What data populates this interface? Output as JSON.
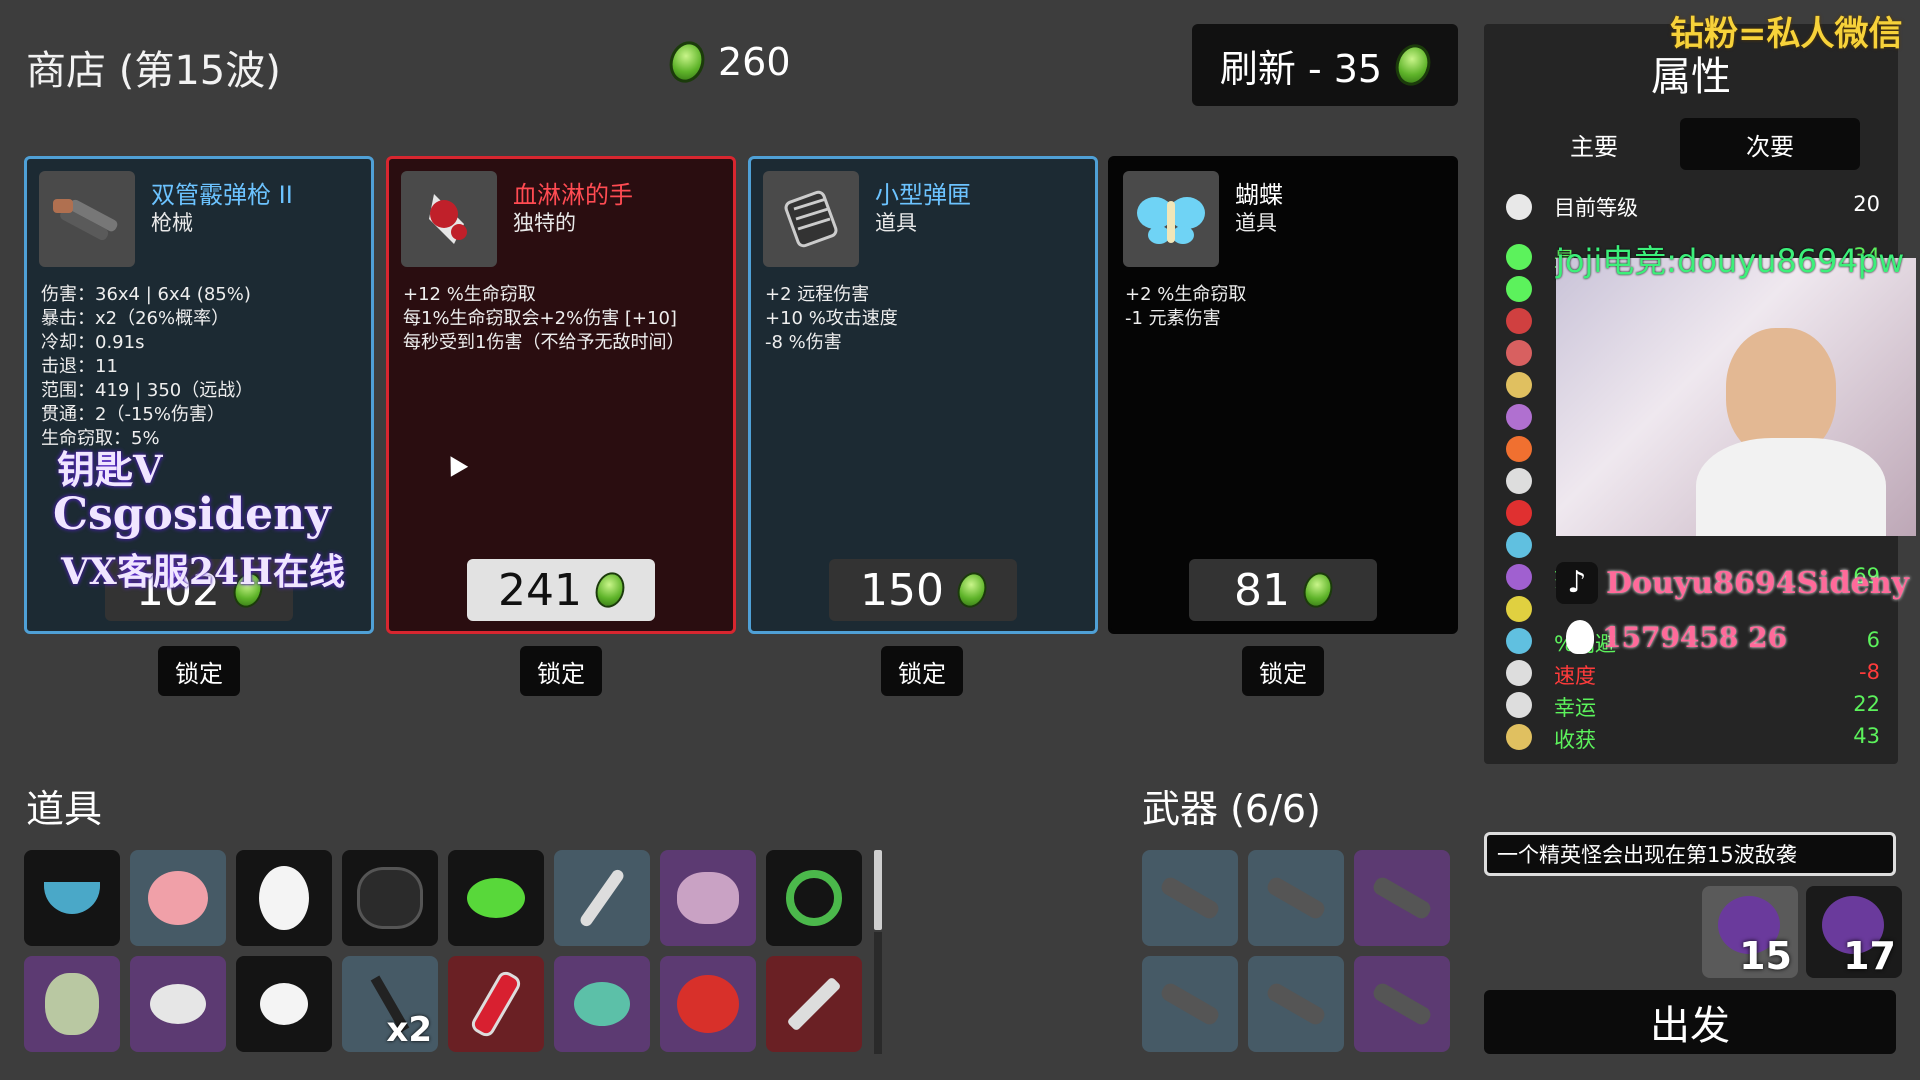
{
  "shop": {
    "title": "商店 (第15波)",
    "gold": "260",
    "refresh_label": "刷新 - 35"
  },
  "cards": [
    {
      "name": "双管霰弹枪 II",
      "type": "枪械",
      "price": "102",
      "stats": [
        "伤害：36x4 | 6x4 (85%)",
        "暴击：x2（26%概率）",
        "冷却：0.91s",
        "击退：11",
        "范围：419 | 350（远战）",
        "贯通：2（-15%伤害）",
        "生命窃取：5%"
      ],
      "lock": "锁定"
    },
    {
      "name": "血淋淋的手",
      "type": "独特的",
      "price": "241",
      "stats": [
        "+12 %生命窃取",
        "每1%生命窃取会+2%伤害 [+10]",
        "每秒受到1伤害（不给予无敌时间）"
      ],
      "lock": "锁定"
    },
    {
      "name": "小型弹匣",
      "type": "道具",
      "price": "150",
      "stats": [
        "+2 远程伤害",
        "+10 %攻击速度",
        "-8 %伤害"
      ],
      "lock": "锁定"
    },
    {
      "name": "蝴蝶",
      "type": "道具",
      "price": "81",
      "stats": [
        "+2 %生命窃取",
        "-1 元素伤害"
      ],
      "lock": "锁定"
    }
  ],
  "items_section": {
    "title": "道具",
    "extra_qty": "x2",
    "items": [
      "soup-bowl-icon",
      "pig-icon",
      "egg-face-icon",
      "coal-icon",
      "slime-icon",
      "scepter-icon",
      "brain-icon",
      "snake-icon",
      "mummy-icon",
      "mouse-icon",
      "white-egg-icon",
      "lamp-icon",
      "vial-icon",
      "chameleon-icon",
      "tomato-icon",
      "syringe-icon"
    ]
  },
  "weapons_section": {
    "title": "武器 (6/6)"
  },
  "stats_panel": {
    "title": "属性",
    "tab_primary": "主要",
    "tab_secondary": "次要",
    "level_label": "目前等级",
    "level_value": "20",
    "rows": [
      {
        "label": "最",
        "value": "34"
      },
      {
        "label": "范围",
        "value": "69"
      },
      {
        "label": "%闪避",
        "value": "6"
      },
      {
        "label": "速度",
        "value": "-8"
      },
      {
        "label": "幸运",
        "value": "22"
      },
      {
        "label": "收获",
        "value": "43"
      }
    ]
  },
  "wave_notice": "一个精英怪会出现在第15波敌袭",
  "enemies": [
    "15",
    "17"
  ],
  "go_button": "出发",
  "overlay": {
    "top_right": "钻粉=私人微信",
    "stream_line": "joji电竞:douyu8694pw",
    "douyin": "Douyu8694Sideny",
    "qq": "1579458 26",
    "promo1": "钥匙V",
    "promo2": "Csgosideny",
    "promo3": "VX客服24H在线"
  },
  "colors": {
    "gem": "#5fb42a",
    "blue_border": "#4fa0d6",
    "red_border": "#d8262f",
    "positive": "#5cf25c",
    "negative": "#ff3b3b"
  }
}
